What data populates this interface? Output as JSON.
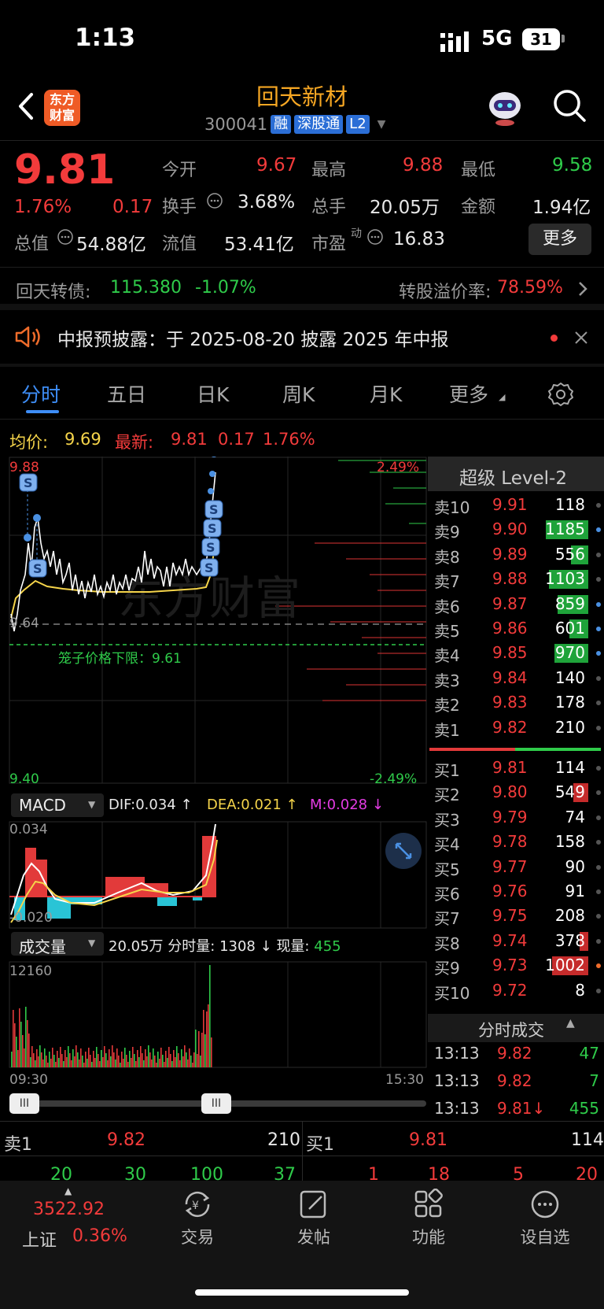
{
  "status": {
    "time": "1:13",
    "network": "5G",
    "battery": "31"
  },
  "header": {
    "logo_line1": "东方",
    "logo_line2": "财富",
    "name": "回天新材",
    "code": "300041",
    "tags": [
      "融",
      "深股通",
      "L2"
    ]
  },
  "quote": {
    "price": "9.81",
    "pct": "1.76%",
    "change": "0.17",
    "open_label": "今开",
    "open": "9.67",
    "high_label": "最高",
    "high": "9.88",
    "low_label": "最低",
    "low": "9.58",
    "turnover_label": "换手",
    "turnover": "3.68%",
    "volume_label": "总手",
    "volume": "20.05万",
    "amount_label": "金额",
    "amount": "1.94亿",
    "mktcap_label": "总值",
    "mktcap": "54.88亿",
    "float_label": "流值",
    "float": "53.41亿",
    "pe_label": "市盈",
    "pe_sup": "动",
    "pe": "16.83",
    "more": "更多"
  },
  "bond": {
    "name": "回天转债:",
    "price": "115.380",
    "pct": "-1.07%",
    "premium_label": "转股溢价率:",
    "premium": "78.59%"
  },
  "notice": {
    "text": "中报预披露：于 2025-08-20 披露 2025 年中报"
  },
  "tabs": [
    {
      "label": "分时"
    },
    {
      "label": "五日"
    },
    {
      "label": "日K"
    },
    {
      "label": "周K"
    },
    {
      "label": "月K"
    },
    {
      "label": "更多"
    }
  ],
  "avg": {
    "label": "均价:",
    "value": "9.69",
    "last_label": "最新:",
    "last": "9.81",
    "chg": "0.17",
    "pct": "1.76%"
  },
  "chart": {
    "y_top": "9.88",
    "y_bottom": "9.40",
    "pct_top": "2.49%",
    "pct_bottom": "-2.49%",
    "prev_close": "9.64",
    "cage_label": "笼子价格下限：",
    "cage_value": "9.61",
    "watermark": "东方财富",
    "macd": {
      "name": "MACD",
      "dif": "DIF:0.034 ↑",
      "dea": "DEA:0.021 ↑",
      "m": "M:0.028 ↓",
      "top": "0.034",
      "bottom": "-0.020"
    },
    "vol": {
      "name": "成交量",
      "total": "20.05万",
      "min_label": "分时量:",
      "min_val": "1308 ↓",
      "cur_label": "现量:",
      "cur_val": "455",
      "top": "12160"
    },
    "time_start": "09:30",
    "time_end": "15:30"
  },
  "chart_data": {
    "type": "line",
    "y_range": [
      9.4,
      9.88
    ],
    "prev_close": 9.64,
    "avg_price": 9.69,
    "last_price": 9.81
  },
  "orderbook": {
    "title": "超级 Level-2",
    "asks": [
      {
        "label": "卖10",
        "price": "9.91",
        "vol": "118",
        "bar": 0
      },
      {
        "label": "卖9",
        "price": "9.90",
        "vol": "1185",
        "bar": 1.0
      },
      {
        "label": "卖8",
        "price": "9.89",
        "vol": "556",
        "bar": 0.4
      },
      {
        "label": "卖7",
        "price": "9.88",
        "vol": "1103",
        "bar": 0.93
      },
      {
        "label": "卖6",
        "price": "9.87",
        "vol": "859",
        "bar": 0.72
      },
      {
        "label": "卖5",
        "price": "9.86",
        "vol": "601",
        "bar": 0.45
      },
      {
        "label": "卖4",
        "price": "9.85",
        "vol": "970",
        "bar": 0.8
      },
      {
        "label": "卖3",
        "price": "9.84",
        "vol": "140",
        "bar": 0
      },
      {
        "label": "卖2",
        "price": "9.83",
        "vol": "178",
        "bar": 0
      },
      {
        "label": "卖1",
        "price": "9.82",
        "vol": "210",
        "bar": 0
      }
    ],
    "bids": [
      {
        "label": "买1",
        "price": "9.81",
        "vol": "114",
        "bar": 0
      },
      {
        "label": "买2",
        "price": "9.80",
        "vol": "549",
        "bar": 0.35
      },
      {
        "label": "买3",
        "price": "9.79",
        "vol": "74",
        "bar": 0
      },
      {
        "label": "买4",
        "price": "9.78",
        "vol": "158",
        "bar": 0
      },
      {
        "label": "买5",
        "price": "9.77",
        "vol": "90",
        "bar": 0
      },
      {
        "label": "买6",
        "price": "9.76",
        "vol": "91",
        "bar": 0
      },
      {
        "label": "买7",
        "price": "9.75",
        "vol": "208",
        "bar": 0
      },
      {
        "label": "买8",
        "price": "9.74",
        "vol": "378",
        "bar": 0.2
      },
      {
        "label": "买9",
        "price": "9.73",
        "vol": "1002",
        "bar": 0.85
      },
      {
        "label": "买10",
        "price": "9.72",
        "vol": "8",
        "bar": 0
      }
    ]
  },
  "ticks": {
    "title": "分时成交",
    "rows": [
      {
        "time": "13:13",
        "price": "9.82",
        "vol": "47"
      },
      {
        "time": "13:13",
        "price": "9.82",
        "vol": "7"
      },
      {
        "time": "13:13",
        "price": "9.81↓",
        "vol": "455"
      }
    ]
  },
  "bottom_quote": {
    "ask_label": "卖1",
    "ask_price": "9.82",
    "ask_vol": "210",
    "bid_label": "买1",
    "bid_price": "9.81",
    "bid_vol": "114",
    "ask_detail": [
      "20",
      "30",
      "100",
      "37"
    ],
    "bid_detail": [
      "1",
      "18",
      "5",
      "20"
    ]
  },
  "nav": {
    "index_value": "3522.92",
    "index_name": "上证",
    "index_pct": "0.36%",
    "items": [
      {
        "label": "交易"
      },
      {
        "label": "发帖"
      },
      {
        "label": "功能"
      },
      {
        "label": "设自选"
      }
    ]
  }
}
